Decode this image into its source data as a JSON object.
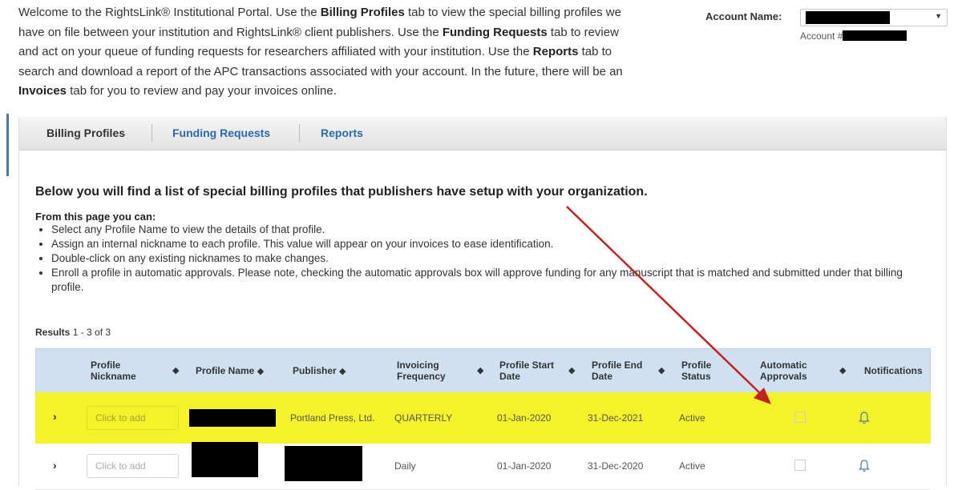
{
  "intro": {
    "p1": "Welcome to the RightsLink® Institutional Portal. Use the ",
    "b1": "Billing Profiles",
    "p2": " tab to view the special billing profiles we have on file between your institution and RightsLink® client publishers. Use the ",
    "b2": "Funding Requests",
    "p3": " tab to review and act on your queue of funding requests for researchers affiliated with your institution. Use the ",
    "b3": "Reports",
    "p4": " tab to search and download a report of the APC transactions associated with your account. In the future, there will be an ",
    "b4": "Invoices",
    "p5": " tab for you to review and pay your invoices online."
  },
  "account": {
    "label": "Account Name:",
    "number_label": "Account #"
  },
  "tabs": [
    {
      "label": "Billing Profiles"
    },
    {
      "label": "Funding Requests"
    },
    {
      "label": "Reports"
    }
  ],
  "heading": "Below you will find a list of special billing profiles that publishers have setup with your organization.",
  "from_label": "From this page you can:",
  "bullets": [
    "Select any Profile Name to view the details of that profile.",
    "Assign an internal nickname to each profile. This value will appear on your invoices to ease identification.",
    "Double-click on any existing nicknames to make changes.",
    "Enroll a profile in automatic approvals. Please note, checking the automatic approvals box will approve funding for any manuscript that is matched and submitted under that billing profile."
  ],
  "results": {
    "label": "Results",
    "range": "1 - 3 of 3"
  },
  "columns": {
    "nickname_1": "Profile",
    "nickname_2": "Nickname",
    "profile_name": "Profile Name",
    "publisher": "Publisher",
    "invoicing_1": "Invoicing",
    "invoicing_2": "Frequency",
    "start_1": "Profile Start",
    "start_2": "Date",
    "end_1": "Profile End",
    "end_2": "Date",
    "status_1": "Profile",
    "status_2": "Status",
    "auto_1": "Automatic",
    "auto_2": "Approvals",
    "notifications": "Notifications"
  },
  "rows": [
    {
      "nickname_placeholder": "Click to add",
      "publisher": "Portland Press, Ltd.",
      "frequency": "QUARTERLY",
      "start": "01-Jan-2020",
      "end": "31-Dec-2021",
      "status": "Active",
      "auto_approval": false
    },
    {
      "nickname_placeholder": "Click to add",
      "publisher": "",
      "frequency": "Daily",
      "start": "01-Jan-2020",
      "end": "31-Dec-2020",
      "status": "Active",
      "auto_approval": false
    }
  ],
  "colors": {
    "highlight": "#f4f32a",
    "link": "#2a6ab0",
    "header_bg": "#cfe0f1",
    "arrow": "#c82020"
  }
}
